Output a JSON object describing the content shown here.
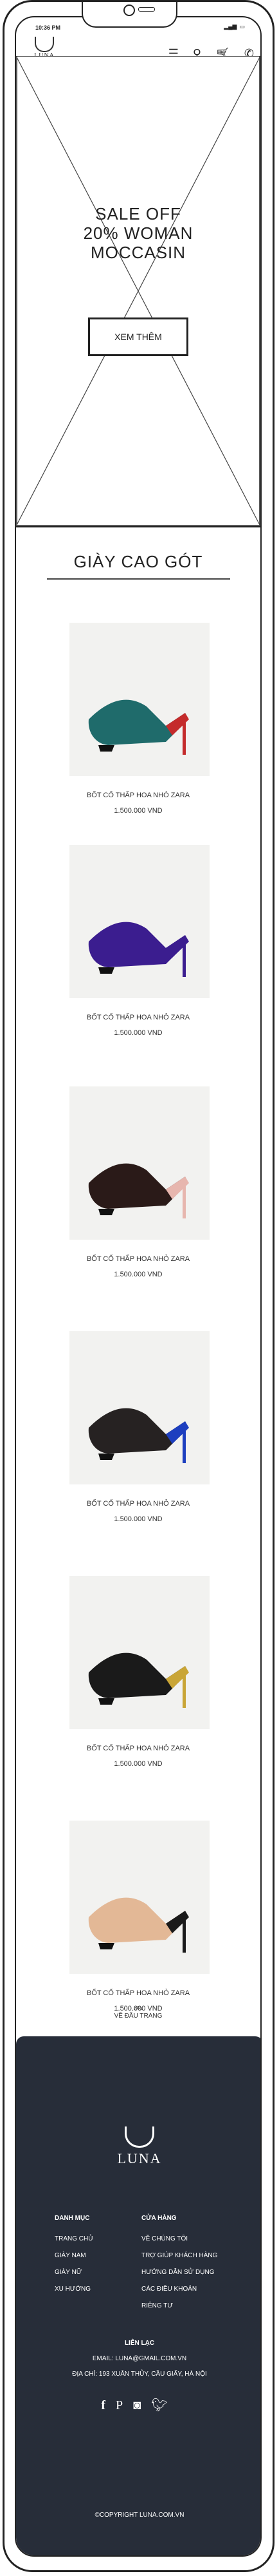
{
  "status": {
    "time": "10:36 PM",
    "signal": "▂▄▆",
    "battery": "▭"
  },
  "brand": {
    "name": "LUNA"
  },
  "nav": {
    "menu_icon": "menu-icon",
    "search_icon": "search-icon",
    "cart_icon": "cart-icon",
    "phone_icon": "phone-icon"
  },
  "hero": {
    "line1": "SALE OFF",
    "line2": "20% WOMAN",
    "line3": "MOCCASIN",
    "button": "XEM THÊM"
  },
  "section": {
    "title": "GIÀY CAO GÓT"
  },
  "products": [
    {
      "name": "BỐT CỔ THẤP HOA NHỎ ZARA",
      "price": "1.500.000 VND",
      "color": "#1f6b6b",
      "accent": "#c42b2b"
    },
    {
      "name": "BỐT CỔ THẤP HOA NHỎ ZARA",
      "price": "1.500.000 VND",
      "color": "#3b1d8f",
      "accent": "#3b1d8f"
    },
    {
      "name": "BỐT CỔ THẤP HOA NHỎ ZARA",
      "price": "1.500.000 VND",
      "color": "#2a1a18",
      "accent": "#e7b6ae"
    },
    {
      "name": "BỐT CỔ THẤP HOA NHỎ ZARA",
      "price": "1.500.000 VND",
      "color": "#262222",
      "accent": "#1d3fbf"
    },
    {
      "name": "BỐT CỔ THẤP HOA NHỎ ZARA",
      "price": "1.500.000 VND",
      "color": "#1a1a1a",
      "accent": "#c9a536"
    },
    {
      "name": "BỐT CỔ THẤP HOA NHỎ ZARA",
      "price": "1.500.000 VND",
      "color": "#e3b896",
      "accent": "#1a1a1a"
    }
  ],
  "back_to_top": {
    "label": "VỀ ĐẦU TRANG",
    "icon": "double-chevron-up-icon"
  },
  "footer": {
    "col1": {
      "head": "DANH MỤC",
      "items": [
        "TRANG CHỦ",
        "GIÀY NAM",
        "GIÀY NỮ",
        "XU HƯỚNG"
      ]
    },
    "col2": {
      "head": "CỬA HÀNG",
      "items": [
        "VỀ CHÚNG TÔI",
        "TRỢ GIÚP KHÁCH HÀNG",
        "HƯỚNG DẪN SỬ DỤNG",
        "CÁC ĐIỀU KHOẢN",
        "RIÊNG TƯ"
      ]
    },
    "contact_head": "LIÊN LẠC",
    "email": "EMAIL: LUNA@GMAIL.COM.VN",
    "address": "ĐỊA CHỈ: 193 XUÂN THỦY, CẦU GIẤY, HÀ NỘI",
    "social": [
      "facebook-icon",
      "pinterest-icon",
      "instagram-icon",
      "twitter-icon"
    ],
    "copyright": "©COPYRIGHT LUNA.COM.VN"
  }
}
